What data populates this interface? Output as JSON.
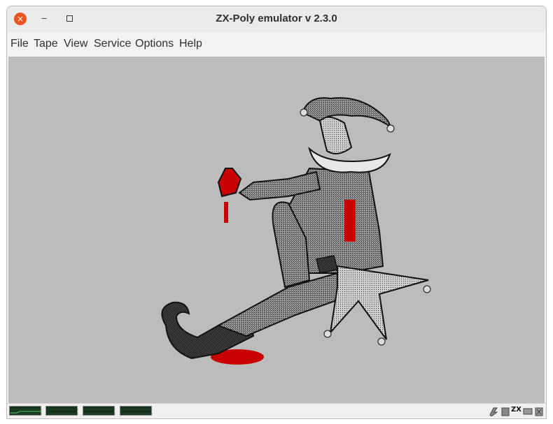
{
  "window": {
    "title": "ZX-Poly emulator v 2.3.0"
  },
  "titlebar": {
    "close_glyph": "×",
    "minimize_glyph": "–"
  },
  "menu": [
    "File",
    "Tape",
    "View",
    "Service",
    "Options",
    "Help"
  ],
  "toolbar": {
    "buttons": [
      {
        "name": "sound-toggle",
        "icon": "speaker-icon",
        "active": true
      },
      {
        "name": "tape-toggle",
        "icon": "cassette-icon",
        "active": false
      },
      {
        "name": "tape-record",
        "icon": "voicemail-icon",
        "active": false
      },
      {
        "name": "virtual-keyboard",
        "icon": "keyboard-icon",
        "active": false
      },
      {
        "name": "pause",
        "icon": "pause-icon",
        "active": false
      }
    ]
  },
  "screen": {
    "background": "#bcbcbc",
    "image": "jester-with-heart-icon"
  },
  "status": {
    "performance_meters": 4,
    "indicator_icons": [
      "turbo-icon",
      "disk-icon",
      "zx-mode-icon",
      "tape-status-icon",
      "trash-icon"
    ],
    "zx_label": "ZX"
  },
  "colors": {
    "accent_close": "#e95420",
    "pause_orange": "#e8961e",
    "blood_red": "#c80000"
  }
}
